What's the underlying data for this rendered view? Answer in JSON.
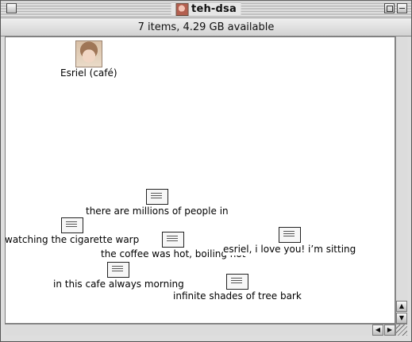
{
  "window": {
    "title": "teh-dsa",
    "status_text": "7 items, 4.29 GB available"
  },
  "items": [
    {
      "label": "Esriel (café)",
      "icon": "person-avatar-icon"
    },
    {
      "label": "there are millions of people in",
      "icon": "text-document-icon"
    },
    {
      "label": "watching the cigarette warp",
      "icon": "text-document-icon"
    },
    {
      "label": "the coffee was hot, boiling hot",
      "icon": "text-document-icon"
    },
    {
      "label": "esriel, i love you! i’m sitting",
      "icon": "text-document-icon"
    },
    {
      "label": "in this cafe always morning",
      "icon": "text-document-icon"
    },
    {
      "label": "infinite shades of tree bark",
      "icon": "text-document-icon"
    }
  ]
}
